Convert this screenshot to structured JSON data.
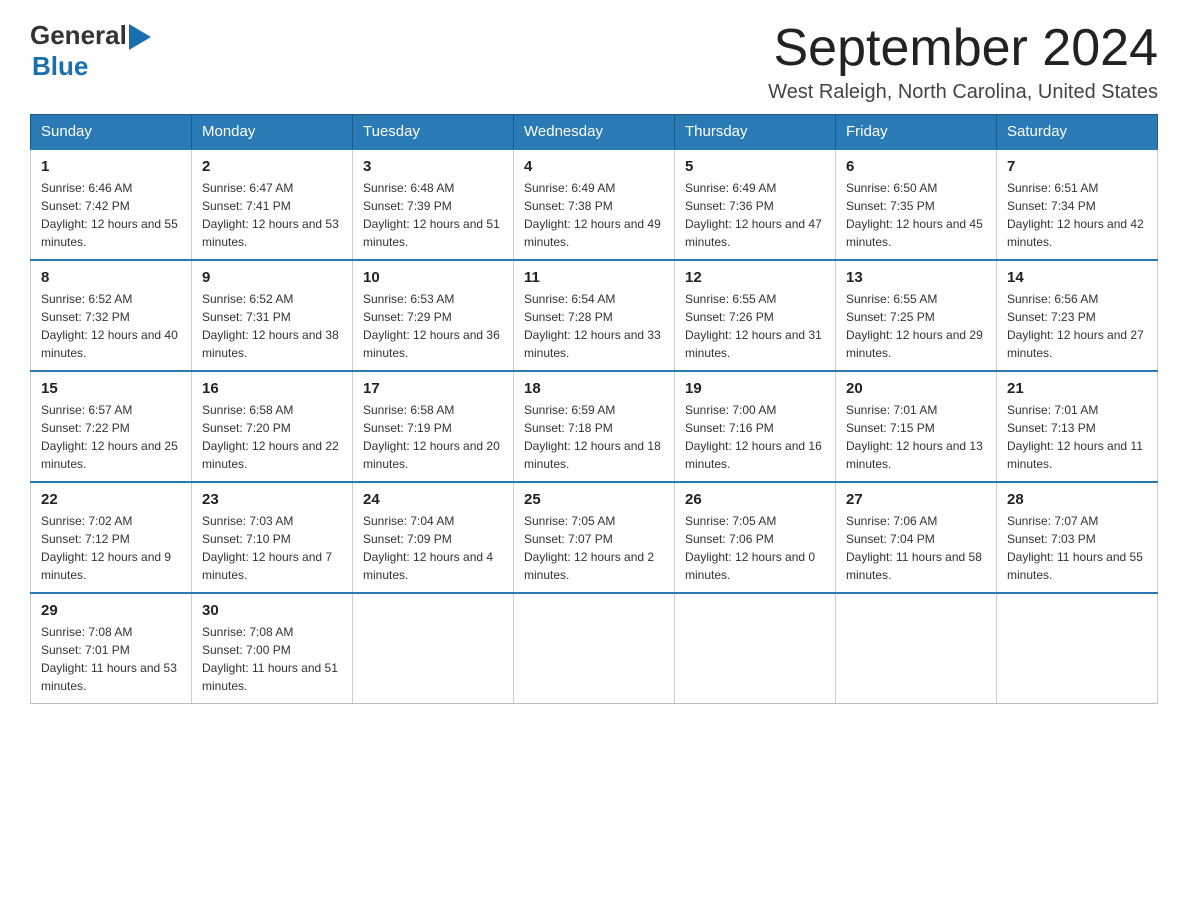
{
  "header": {
    "logo_general": "General",
    "logo_blue": "Blue",
    "month_year": "September 2024",
    "location": "West Raleigh, North Carolina, United States"
  },
  "days_of_week": [
    "Sunday",
    "Monday",
    "Tuesday",
    "Wednesday",
    "Thursday",
    "Friday",
    "Saturday"
  ],
  "weeks": [
    [
      {
        "day": "1",
        "sunrise": "6:46 AM",
        "sunset": "7:42 PM",
        "daylight": "12 hours and 55 minutes."
      },
      {
        "day": "2",
        "sunrise": "6:47 AM",
        "sunset": "7:41 PM",
        "daylight": "12 hours and 53 minutes."
      },
      {
        "day": "3",
        "sunrise": "6:48 AM",
        "sunset": "7:39 PM",
        "daylight": "12 hours and 51 minutes."
      },
      {
        "day": "4",
        "sunrise": "6:49 AM",
        "sunset": "7:38 PM",
        "daylight": "12 hours and 49 minutes."
      },
      {
        "day": "5",
        "sunrise": "6:49 AM",
        "sunset": "7:36 PM",
        "daylight": "12 hours and 47 minutes."
      },
      {
        "day": "6",
        "sunrise": "6:50 AM",
        "sunset": "7:35 PM",
        "daylight": "12 hours and 45 minutes."
      },
      {
        "day": "7",
        "sunrise": "6:51 AM",
        "sunset": "7:34 PM",
        "daylight": "12 hours and 42 minutes."
      }
    ],
    [
      {
        "day": "8",
        "sunrise": "6:52 AM",
        "sunset": "7:32 PM",
        "daylight": "12 hours and 40 minutes."
      },
      {
        "day": "9",
        "sunrise": "6:52 AM",
        "sunset": "7:31 PM",
        "daylight": "12 hours and 38 minutes."
      },
      {
        "day": "10",
        "sunrise": "6:53 AM",
        "sunset": "7:29 PM",
        "daylight": "12 hours and 36 minutes."
      },
      {
        "day": "11",
        "sunrise": "6:54 AM",
        "sunset": "7:28 PM",
        "daylight": "12 hours and 33 minutes."
      },
      {
        "day": "12",
        "sunrise": "6:55 AM",
        "sunset": "7:26 PM",
        "daylight": "12 hours and 31 minutes."
      },
      {
        "day": "13",
        "sunrise": "6:55 AM",
        "sunset": "7:25 PM",
        "daylight": "12 hours and 29 minutes."
      },
      {
        "day": "14",
        "sunrise": "6:56 AM",
        "sunset": "7:23 PM",
        "daylight": "12 hours and 27 minutes."
      }
    ],
    [
      {
        "day": "15",
        "sunrise": "6:57 AM",
        "sunset": "7:22 PM",
        "daylight": "12 hours and 25 minutes."
      },
      {
        "day": "16",
        "sunrise": "6:58 AM",
        "sunset": "7:20 PM",
        "daylight": "12 hours and 22 minutes."
      },
      {
        "day": "17",
        "sunrise": "6:58 AM",
        "sunset": "7:19 PM",
        "daylight": "12 hours and 20 minutes."
      },
      {
        "day": "18",
        "sunrise": "6:59 AM",
        "sunset": "7:18 PM",
        "daylight": "12 hours and 18 minutes."
      },
      {
        "day": "19",
        "sunrise": "7:00 AM",
        "sunset": "7:16 PM",
        "daylight": "12 hours and 16 minutes."
      },
      {
        "day": "20",
        "sunrise": "7:01 AM",
        "sunset": "7:15 PM",
        "daylight": "12 hours and 13 minutes."
      },
      {
        "day": "21",
        "sunrise": "7:01 AM",
        "sunset": "7:13 PM",
        "daylight": "12 hours and 11 minutes."
      }
    ],
    [
      {
        "day": "22",
        "sunrise": "7:02 AM",
        "sunset": "7:12 PM",
        "daylight": "12 hours and 9 minutes."
      },
      {
        "day": "23",
        "sunrise": "7:03 AM",
        "sunset": "7:10 PM",
        "daylight": "12 hours and 7 minutes."
      },
      {
        "day": "24",
        "sunrise": "7:04 AM",
        "sunset": "7:09 PM",
        "daylight": "12 hours and 4 minutes."
      },
      {
        "day": "25",
        "sunrise": "7:05 AM",
        "sunset": "7:07 PM",
        "daylight": "12 hours and 2 minutes."
      },
      {
        "day": "26",
        "sunrise": "7:05 AM",
        "sunset": "7:06 PM",
        "daylight": "12 hours and 0 minutes."
      },
      {
        "day": "27",
        "sunrise": "7:06 AM",
        "sunset": "7:04 PM",
        "daylight": "11 hours and 58 minutes."
      },
      {
        "day": "28",
        "sunrise": "7:07 AM",
        "sunset": "7:03 PM",
        "daylight": "11 hours and 55 minutes."
      }
    ],
    [
      {
        "day": "29",
        "sunrise": "7:08 AM",
        "sunset": "7:01 PM",
        "daylight": "11 hours and 53 minutes."
      },
      {
        "day": "30",
        "sunrise": "7:08 AM",
        "sunset": "7:00 PM",
        "daylight": "11 hours and 51 minutes."
      },
      null,
      null,
      null,
      null,
      null
    ]
  ],
  "cell_labels": {
    "sunrise": "Sunrise:",
    "sunset": "Sunset:",
    "daylight": "Daylight:"
  }
}
